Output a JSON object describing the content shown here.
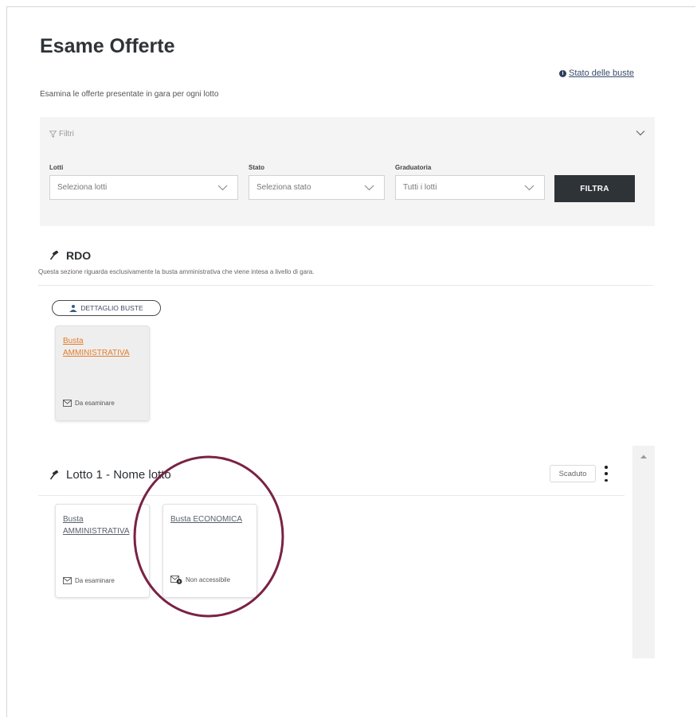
{
  "page": {
    "title": "Esame Offerte",
    "subtitle": "Esamina le offerte presentate in gara per ogni lotto",
    "status_link": "Stato delle buste"
  },
  "filters": {
    "header_label": "Filtri",
    "lotti": {
      "label": "Lotti",
      "value": "Seleziona lotti"
    },
    "stato": {
      "label": "Stato",
      "value": "Seleziona stato"
    },
    "graduatoria": {
      "label": "Graduatoria",
      "value": "Tutti i lotti"
    },
    "button_label": "FILTRA"
  },
  "rdo": {
    "title": "RDO",
    "description": "Questa sezione riguarda esclusivamente la busta amministrativa che viene intesa a livello di gara.",
    "details_button": "DETTAGLIO BUSTE",
    "card": {
      "link": "Busta AMMINISTRATIVA",
      "status": "Da esaminare"
    }
  },
  "lotto": {
    "title": "Lotto 1 - Nome lotto",
    "badge": "Scaduto",
    "cards": [
      {
        "link": "Busta AMMINISTRATIVA",
        "status": "Da esaminare"
      },
      {
        "link": "Busta ECONOMICA",
        "status": "Non accessibile"
      }
    ]
  },
  "colors": {
    "accent_orange": "#e37c2a",
    "dark_button": "#2e3338",
    "annotation_circle": "#7a2244"
  },
  "icons": [
    "info-icon",
    "filter-icon",
    "chevron-down-icon",
    "gavel-icon",
    "users-icon",
    "envelope-icon",
    "envelope-lock-icon",
    "kebab-menu-icon",
    "scroll-up-icon"
  ]
}
